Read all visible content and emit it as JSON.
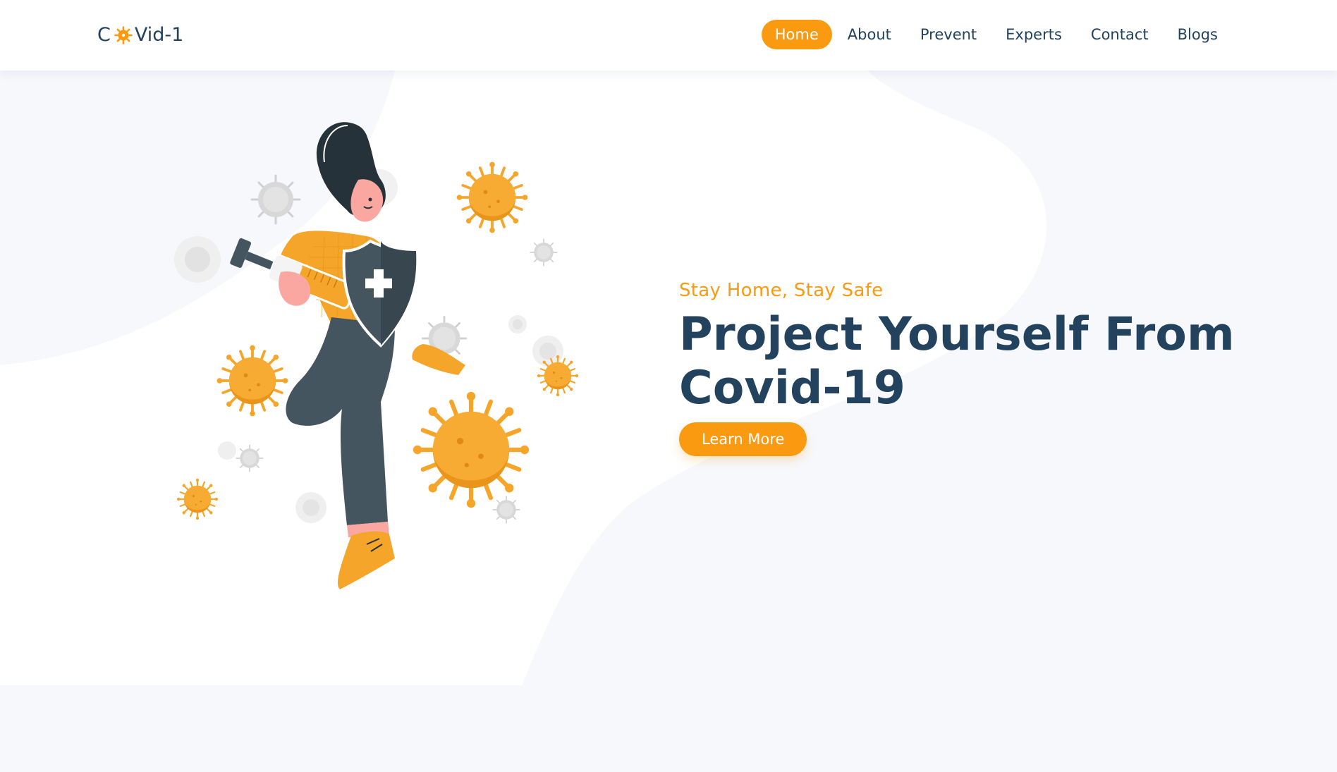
{
  "brand": {
    "prefix": "C",
    "suffix": "Vid-1",
    "icon": "virus-icon"
  },
  "nav": {
    "items": [
      {
        "label": "Home",
        "active": true
      },
      {
        "label": "About",
        "active": false
      },
      {
        "label": "Prevent",
        "active": false
      },
      {
        "label": "Experts",
        "active": false
      },
      {
        "label": "Contact",
        "active": false
      },
      {
        "label": "Blogs",
        "active": false
      }
    ]
  },
  "hero": {
    "subtitle": "Stay Home, Stay Safe",
    "title_line1": "Project Yourself From",
    "title_line2": "Covid-19",
    "cta_label": "Learn More"
  },
  "colors": {
    "accent": "#f99a10",
    "heading": "#22425e",
    "background": "#f7f8fc"
  }
}
